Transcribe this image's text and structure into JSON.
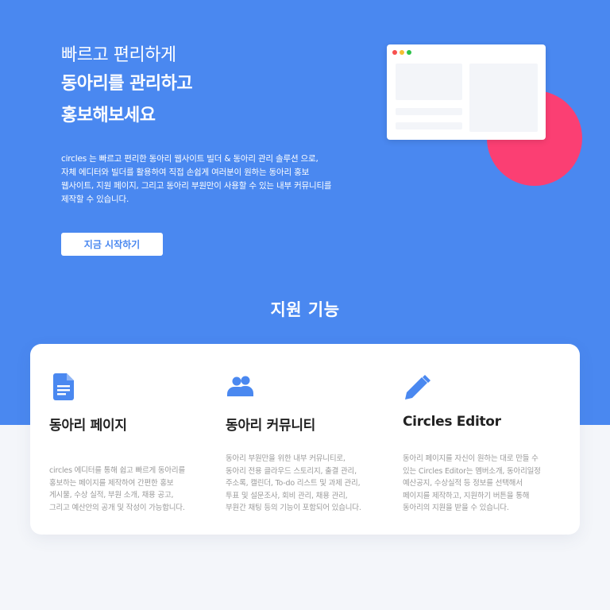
{
  "colors": {
    "hero_background": "#4a88f0",
    "accent_circle": "#fb3f73",
    "page_background": "#f4f6fa",
    "feature_icon": "#4a88f0"
  },
  "hero": {
    "headline_line1": "빠르고 편리하게",
    "headline_line2": "동아리를 관리하고",
    "headline_line3": "홍보해보세요",
    "description_lines": [
      "circles 는 빠르고 편리한 동아리 웹사이트 빌더 & 동아리 관리 솔루션 으로,",
      "자체 에디터와 빌더를 활용하여 직접 손쉽게 여러분이 원하는 동아리 홍보",
      "웹사이트, 지원 페이지, 그리고 동아리 부원만이 사용할 수 있는 내부 커뮤니티를",
      "제작할 수 있습니다."
    ],
    "cta_label": "지금 시작하기"
  },
  "features_section": {
    "title": "지원 기능",
    "items": [
      {
        "icon": "document-icon",
        "title": "동아리 페이지",
        "description_lines": [
          "circles 에디터를 통해 쉽고 빠르게 동아리를",
          "홍보하는 페이지를 제작하여 간편한 홍보",
          "게시물, 수상 실적, 부원 소개, 채용 공고,",
          "그리고 예산안의 공개 및 작성이 가능합니다."
        ]
      },
      {
        "icon": "people-icon",
        "title": "동아리 커뮤니티",
        "description_lines": [
          "동아리 부원만을 위한 내부 커뮤니티로,",
          "동아리 전용 클라우드 스토리지, 출결 관리,",
          "주소록, 캘린더, To-do 리스트 및 과제 관리,",
          "투표 및 설문조사, 회비 관리, 채용 관리,",
          "부원간 채팅 등의 기능이 포함되어 있습니다."
        ]
      },
      {
        "icon": "pencil-icon",
        "title": "Circles Editor",
        "description_lines": [
          "동아리 페이지를 자신이 원하는 대로 만들 수",
          "있는 Circles Editor는 멤버소개, 동아리일정",
          "예산공지, 수상실적 등 정보를 선택해서",
          "페이지를 제작하고, 지원하기 버튼을 통해",
          "동아리의 지원을 받을 수 있습니다."
        ]
      }
    ]
  }
}
